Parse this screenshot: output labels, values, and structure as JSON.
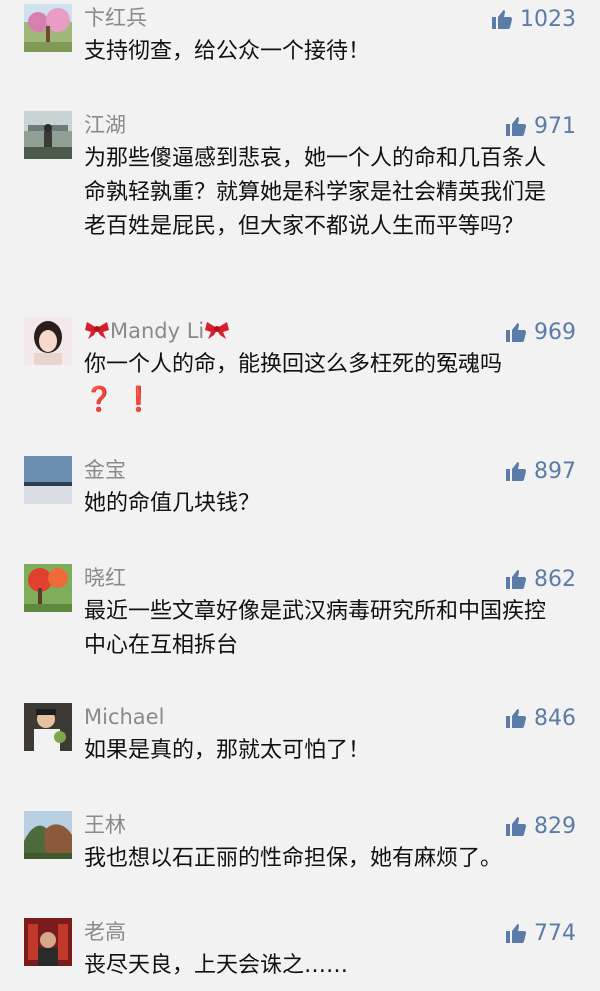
{
  "comments": [
    {
      "name": "卞红兵",
      "likes": "1023",
      "text": "支持彻查，给公众一个接待！"
    },
    {
      "name": "江湖",
      "likes": "971",
      "text": "为那些傻逼感到悲哀，她一个人的命和几百条人命孰轻孰重？就算她是科学家是社会精英我们是老百姓是屁民，但大家不都说人生而平等吗？"
    },
    {
      "name": "Mandy Li",
      "likes": "969",
      "text": "你一个人的命，能换回这么多枉死的冤魂吗",
      "emoji": [
        "❓",
        "❗"
      ]
    },
    {
      "name": "金宝",
      "likes": "897",
      "text": "她的命值几块钱？"
    },
    {
      "name": "晓红",
      "likes": "862",
      "text": "最近一些文章好像是武汉病毒研究所和中国疾控中心在互相拆台"
    },
    {
      "name": "Michael",
      "likes": "846",
      "text": "如果是真的，那就太可怕了！"
    },
    {
      "name": "王林",
      "likes": "829",
      "text": "我也想以石正丽的性命担保，她有麻烦了。"
    },
    {
      "name": "老高",
      "likes": "774",
      "text": "丧尽天良，上天会诛之……"
    }
  ]
}
